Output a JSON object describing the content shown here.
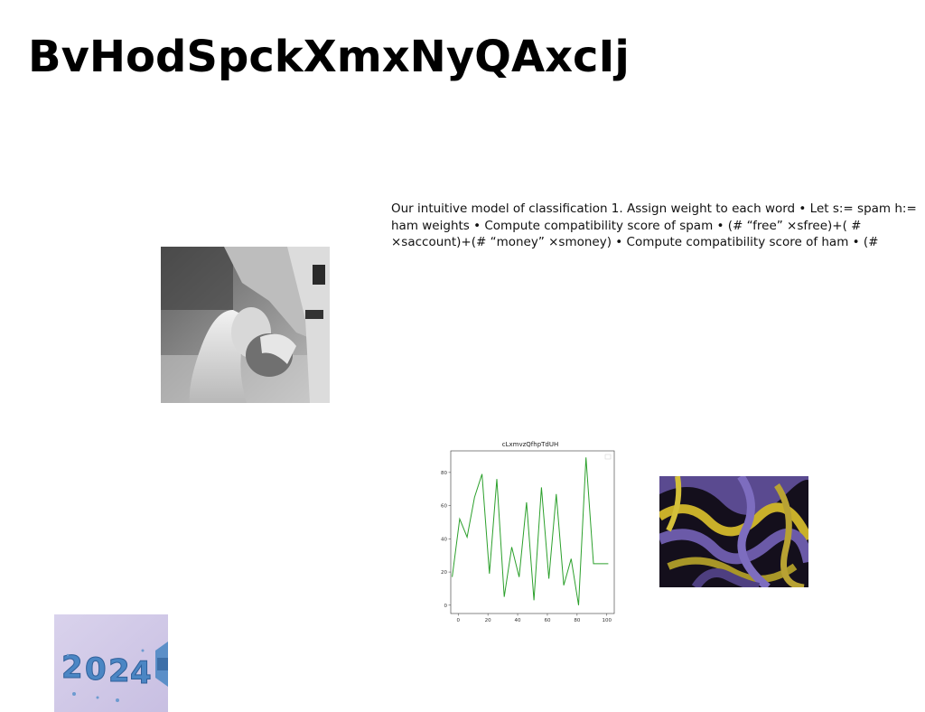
{
  "slide": {
    "title": "BvHodSpckXmxNyQAxcIj",
    "body_text": "Our intuitive model of classification 1. Assign weight to each word • Let s:= spam h:= ham weights • Compute compatibility score of spam • (# “free” ×sfree)+( # ×saccount)+(# “money” ×smoney) • Compute compatibility score of ham • (#"
  },
  "images": {
    "couple_photo": "black-and-white photo of a couple kissing",
    "fluid_art": "abstract swirling purple and yellow fluid art",
    "year_2024": "blue 3D 2024 numerals on lilac background"
  },
  "chart_data": {
    "type": "line",
    "title": "cLxmvzQfhpTdUH",
    "xlabel": "",
    "ylabel": "",
    "xlim": [
      -5,
      105
    ],
    "ylim": [
      -5,
      93
    ],
    "x_ticks": [
      0,
      20,
      40,
      60,
      80,
      100
    ],
    "y_ticks": [
      0,
      20,
      40,
      60,
      80
    ],
    "grid": false,
    "legend": "top-right (empty)",
    "series": [
      {
        "color": "#2ca02c",
        "x": [
          -4,
          1,
          6,
          11,
          16,
          21,
          26,
          31,
          36,
          41,
          46,
          51,
          56,
          61,
          66,
          71,
          76,
          81,
          86,
          91,
          96,
          101
        ],
        "y": [
          17,
          52,
          41,
          65,
          79,
          19,
          76,
          5,
          35,
          17,
          62,
          3,
          71,
          16,
          67,
          12,
          28,
          0,
          89,
          25,
          25,
          25
        ]
      }
    ]
  }
}
